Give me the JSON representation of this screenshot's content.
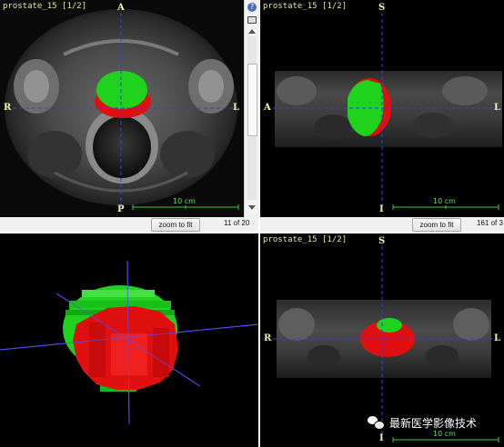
{
  "views": {
    "axial": {
      "series_label": "prostate_15 [1/2]",
      "top": "A",
      "bottom": "P",
      "left": "R",
      "right": "L",
      "scale_label": "10 cm",
      "zoom_button": "zoom to fit",
      "slice_counter": "11 of 20"
    },
    "sagittal": {
      "series_label": "prostate_15 [1/2]",
      "top": "S",
      "bottom": "I",
      "left": "A",
      "right": "L",
      "scale_label": "10 cm",
      "zoom_button": "zoom to fit",
      "slice_counter": "161 of 3"
    },
    "render3d": {},
    "coronal": {
      "series_label": "prostate_15 [1/2]",
      "top": "S",
      "bottom": "I",
      "left": "R",
      "right": "L",
      "scale_label": "10 cm"
    }
  },
  "watermark": {
    "text": "最新医学影像技术",
    "icon": "wechat-icon"
  },
  "colors": {
    "segment_green": "#1ed21e",
    "segment_red": "#e01010",
    "crosshair": "#3a3af0",
    "scale_bar": "#2fd22f",
    "label": "#e6e6a0"
  }
}
